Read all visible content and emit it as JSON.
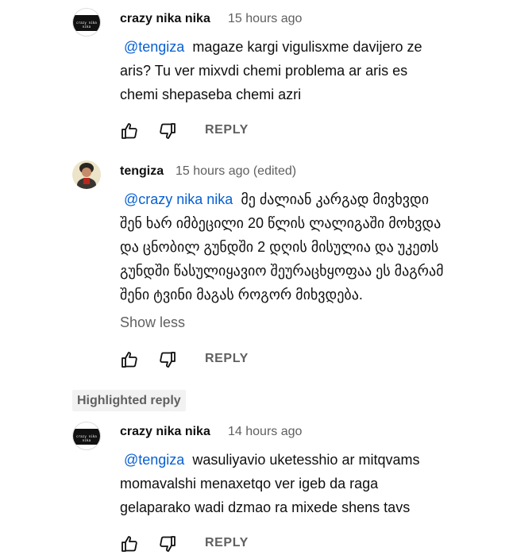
{
  "comments": [
    {
      "author": "crazy nika nika",
      "time": "15 hours ago",
      "mention": "@tengiza",
      "lines": [
        "magaze kargi vigulisxme davijero ze",
        "aris? Tu ver mixvdi chemi problema ar aris es",
        "chemi shepaseba chemi azri"
      ],
      "reply_label": "REPLY",
      "avatar_text": "crazy nika nika"
    },
    {
      "author": "tengiza",
      "time": "15 hours ago (edited)",
      "mention": "@crazy nika nika",
      "lines": [
        "მე ძალიან კარგად მივხვდი",
        "შენ ხარ იმბეცილი 20 წლის ლალიგაში მოხვდა",
        "და ცნობილ გუნდში 2 დღის მისულია და უკეთს",
        "გუნდში წასულიყავიო შეურაცხყოფაა ეს მაგრამ",
        "შენი ტვინი მაგას როგორ მიხვდება."
      ],
      "show_less": "Show less",
      "reply_label": "REPLY"
    },
    {
      "badge": "Highlighted reply",
      "author": "crazy nika nika",
      "time": "14 hours ago",
      "mention": "@tengiza",
      "lines": [
        "wasuliyavio uketesshio ar mitqvams",
        "momavalshi menaxetqo ver igeb da raga",
        "gelaparako wadi dzmao ra mixede shens tavs"
      ],
      "reply_label": "REPLY",
      "avatar_text": "crazy nika nika"
    }
  ],
  "colors": {
    "mention": "#065fd4",
    "secondary_text": "#606060",
    "badge_bg": "#f2f2f2"
  },
  "icons": [
    "like-icon",
    "dislike-icon"
  ]
}
